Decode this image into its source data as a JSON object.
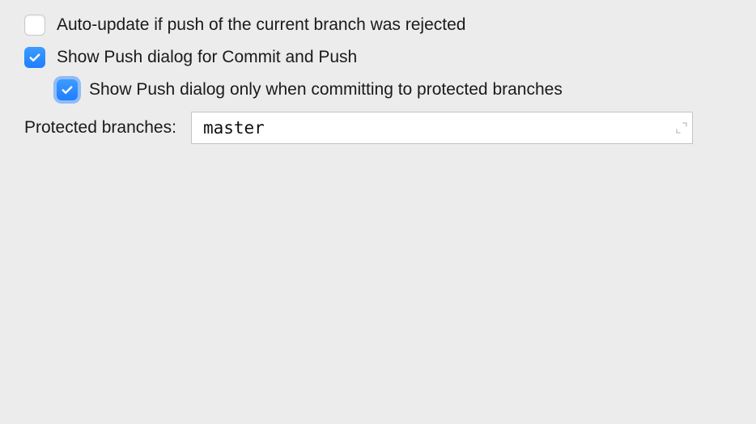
{
  "options": {
    "auto_update": {
      "label": "Auto-update if push of the current branch was rejected",
      "checked": false
    },
    "show_push_dialog": {
      "label": "Show Push dialog for Commit and Push",
      "checked": true
    },
    "show_push_dialog_protected": {
      "label": "Show Push dialog only when committing to protected branches",
      "checked": true,
      "focused": true
    }
  },
  "protected_branches": {
    "label": "Protected branches:",
    "value": "master"
  }
}
